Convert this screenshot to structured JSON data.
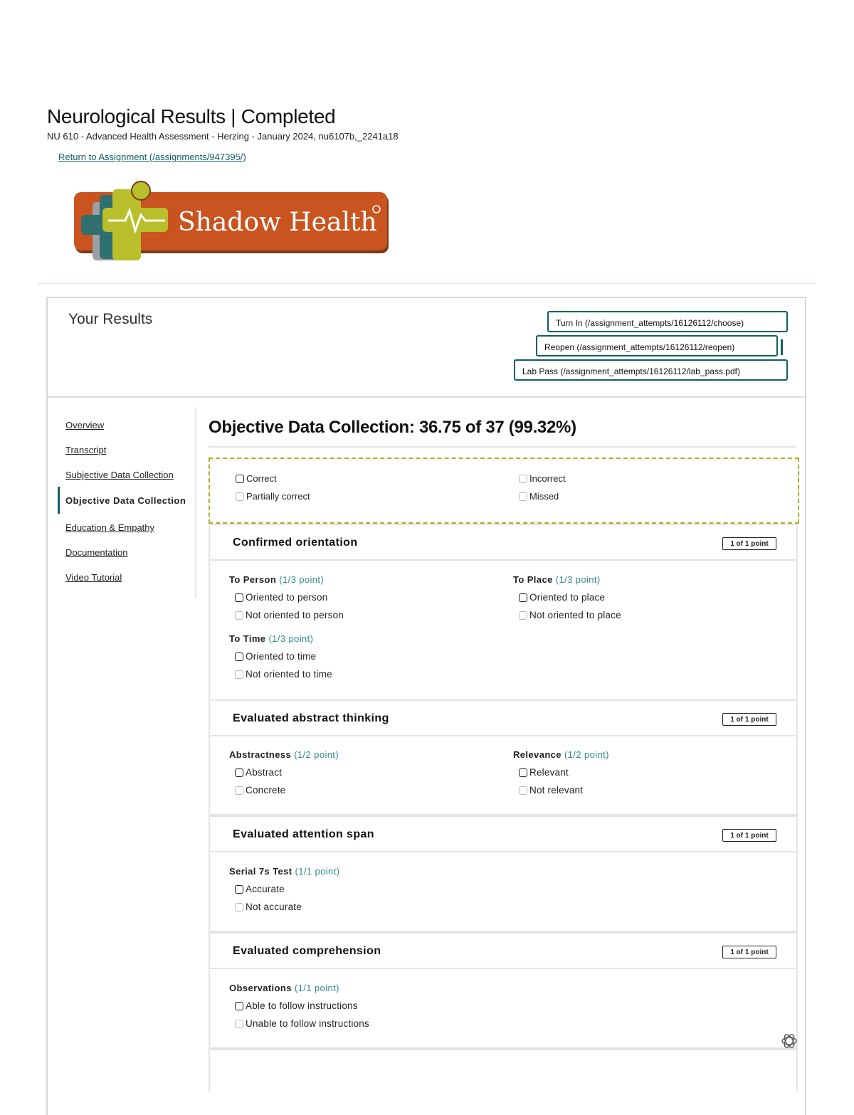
{
  "header": {
    "title": "Neurological Results | Completed",
    "course": "NU 610 - Advanced Health Assessment - Herzing - January 2024, nu6107b,_2241a18",
    "return_link": "Return to Assignment (/assignments/947395/)"
  },
  "logo": {
    "text": "Shadow Health",
    "brand_color": "#c9541f",
    "accent_color": "#b9bf2a"
  },
  "results": {
    "heading": "Your Results",
    "buttons": {
      "turn_in": "Turn In (/assignment_attempts/16126112/choose)",
      "reopen": "Reopen (/assignment_attempts/16126112/reopen)",
      "lab_pass": "Lab Pass (/assignment_attempts/16126112/lab_pass.pdf)"
    }
  },
  "nav": {
    "items": [
      {
        "label": "Overview"
      },
      {
        "label": "Transcript"
      },
      {
        "label": "Subjective Data Collection"
      },
      {
        "label": "Objective Data Collection",
        "active": true
      },
      {
        "label": "Education & Empathy"
      },
      {
        "label": "Documentation"
      },
      {
        "label": "Video Tutorial"
      }
    ]
  },
  "section": {
    "title": "Objective Data Collection: 36.75 of 37 (99.32%)"
  },
  "legend": {
    "correct": "Correct",
    "incorrect": "Incorrect",
    "partial": "Partially correct",
    "missed": "Missed"
  },
  "cards": [
    {
      "title": "Confirmed orientation",
      "points": "1 of 1 point",
      "groups": [
        {
          "label": "To Person",
          "score": "(1/3 point)",
          "options": [
            "Oriented to person",
            "Not oriented to person"
          ]
        },
        {
          "label": "To Place",
          "score": "(1/3 point)",
          "options": [
            "Oriented to place",
            "Not oriented to place"
          ]
        },
        {
          "label": "To Time",
          "score": "(1/3 point)",
          "options": [
            "Oriented to time",
            "Not oriented to time"
          ]
        }
      ]
    },
    {
      "title": "Evaluated abstract thinking",
      "points": "1 of 1 point",
      "groups": [
        {
          "label": "Abstractness",
          "score": "(1/2 point)",
          "options": [
            "Abstract",
            "Concrete"
          ]
        },
        {
          "label": "Relevance",
          "score": "(1/2 point)",
          "options": [
            "Relevant",
            "Not relevant"
          ]
        }
      ]
    },
    {
      "title": "Evaluated attention span",
      "points": "1 of 1 point",
      "groups": [
        {
          "label": "Serial 7s Test",
          "score": "(1/1 point)",
          "options": [
            "Accurate",
            "Not accurate"
          ]
        }
      ]
    },
    {
      "title": "Evaluated comprehension",
      "points": "1 of 1 point",
      "groups": [
        {
          "label": "Observations",
          "score": "(1/1 point)",
          "options": [
            "Able to follow instructions",
            "Unable to follow instructions"
          ]
        }
      ]
    }
  ],
  "colors": {
    "teal": "#0f5e63",
    "score_teal": "#2e8a89",
    "legend_border": "#b0ab1f"
  }
}
